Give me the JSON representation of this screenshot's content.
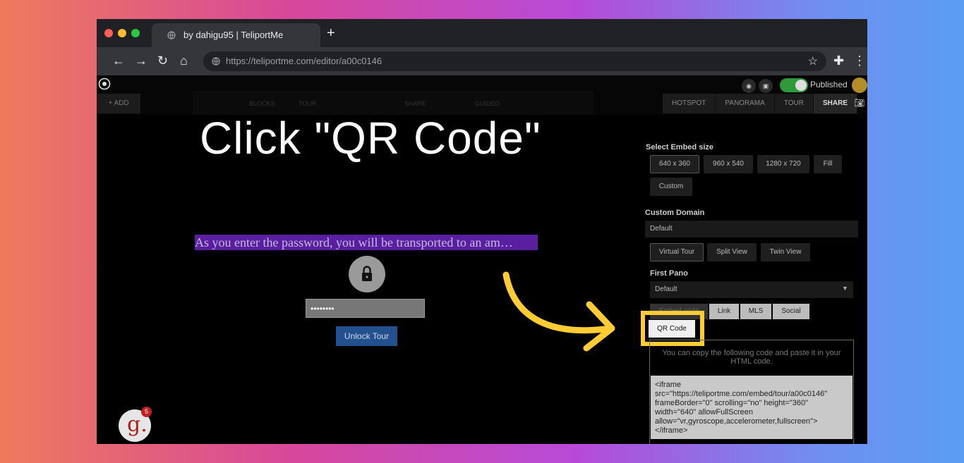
{
  "browser": {
    "tab_title": "by dahigu95 | TeliportMe",
    "new_tab": "+",
    "url": "https://teliportme.com/editor/a00c0146",
    "traffic_colors": [
      "#ff5f57",
      "#febc2e",
      "#28c840"
    ]
  },
  "editor": {
    "add_label": "+ ADD",
    "faint_tabs": [
      "BLOCKS",
      "TOUR",
      "SHARE",
      "GUIDED"
    ],
    "published_label": "Published",
    "right_tabs": [
      "HOTSPOT",
      "PANORAMA",
      "TOUR",
      "SHARE"
    ],
    "active_tab": "SHARE"
  },
  "overlay": {
    "headline": "Click \"QR Code\"",
    "highlight_color": "#ffcc35"
  },
  "viewer": {
    "password_prompt": "As you enter the password, you will be transported to an am…",
    "password_value": "••••••••",
    "unlock_label": "Unlock Tour",
    "badge_letter": "g.",
    "badge_count": "5"
  },
  "share_panel": {
    "embed_size_label": "Select Embed size",
    "sizes": [
      "640 x 360",
      "960 x 540",
      "1280 x 720",
      "Fill"
    ],
    "custom_label": "Custom",
    "custom_domain_label": "Custom Domain",
    "custom_domain_value": "Default",
    "view_modes": [
      "Virtual Tour",
      "Split View",
      "Twin View"
    ],
    "first_pano_label": "First Pano",
    "first_pano_value": "Default",
    "share_tabs": [
      "Embed code",
      "Link",
      "MLS",
      "Social"
    ],
    "qr_label": "QR Code",
    "embed_note": "You can copy the following code and paste it in your HTML code.",
    "embed_code": "<iframe\nsrc=\"https://teliportme.com/embed/tour/a00c0146\"\nframeBorder=\"0\" scrolling=\"no\" height=\"360\"\nwidth=\"640\" allowFullScreen\nallow=\"vr,gyroscope,accelerometer,fullscreen\">\n</iframe>"
  }
}
